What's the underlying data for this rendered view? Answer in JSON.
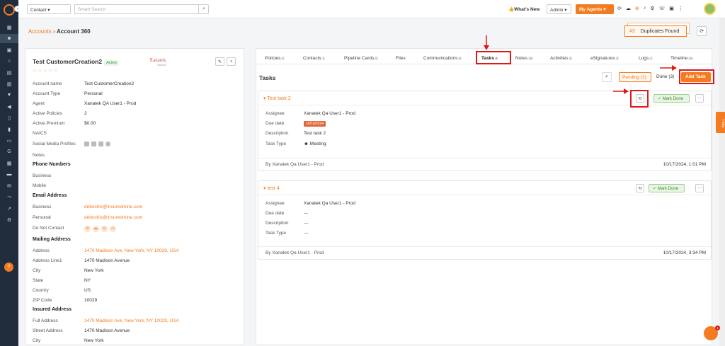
{
  "topbar": {
    "contact_select": "Contact",
    "search_placeholder": "Smart Search",
    "whats_new": "What's New",
    "admin_select": "Admin",
    "my_agents": "My Agents"
  },
  "breadcrumb": {
    "parent": "Accounts",
    "current": "Account 360"
  },
  "duplicates": {
    "count": "#3",
    "label": "Duplicates Found"
  },
  "account": {
    "name": "Test CustomerCreation2",
    "status": "Active",
    "logo_text": "Xanatek",
    "logo_sub": "Insured",
    "stars": "☆☆☆☆☆",
    "fields": [
      {
        "label": "Account name",
        "value": "Test CustomerCreation2"
      },
      {
        "label": "Account Type",
        "value": "Personal"
      },
      {
        "label": "Agent",
        "value": "Xanatek QA User1 - Prod"
      },
      {
        "label": "Active Policies",
        "value": "2"
      },
      {
        "label": "Active Premium",
        "value": "$0.00"
      },
      {
        "label": "NAICS",
        "value": ""
      },
      {
        "label": "Social Media Profiles",
        "value": ""
      },
      {
        "label": "Notes",
        "value": ""
      }
    ],
    "phone_header": "Phone Numbers",
    "phone": [
      {
        "label": "Business",
        "value": ""
      },
      {
        "label": "Mobile",
        "value": ""
      }
    ],
    "email_header": "Email Address",
    "email": [
      {
        "label": "Business",
        "value": "deboshis@insuredmine.com"
      },
      {
        "label": "Personal",
        "value": "deboshis@insuredmine.com"
      },
      {
        "label": "Do Not Contact",
        "value": ""
      }
    ],
    "mailing_header": "Mailing Address",
    "mailing": [
      {
        "label": "Address",
        "value": "1470 Madison Ave, New York, NY 10029, USA"
      },
      {
        "label": "Address Line1",
        "value": "1470 Madison Avenue"
      },
      {
        "label": "City",
        "value": "New York"
      },
      {
        "label": "State",
        "value": "NY"
      },
      {
        "label": "Country",
        "value": "US"
      },
      {
        "label": "ZIP Code",
        "value": "10029"
      }
    ],
    "insured_header": "Insured Address",
    "insured": [
      {
        "label": "Full Address",
        "value": "1470 Madison Ave, New York, NY 10029, USA"
      },
      {
        "label": "Street Address",
        "value": "1470 Madison Avenue"
      },
      {
        "label": "City",
        "value": "New York"
      }
    ]
  },
  "tabs": [
    {
      "label": "Policies",
      "count": "2"
    },
    {
      "label": "Contacts",
      "count": "1"
    },
    {
      "label": "Pipeline Cards",
      "count": "0"
    },
    {
      "label": "Files",
      "count": ""
    },
    {
      "label": "Communications",
      "count": "0"
    },
    {
      "label": "Tasks",
      "count": "0"
    },
    {
      "label": "Notes",
      "count": "10"
    },
    {
      "label": "Activities",
      "count": "0"
    },
    {
      "label": "eSignatures",
      "count": "0"
    },
    {
      "label": "Logs",
      "count": "1"
    },
    {
      "label": "Timeline",
      "count": "41"
    }
  ],
  "tasks": {
    "header": "Tasks",
    "pending": "Pending (2)",
    "done": "Done (3)",
    "add": "Add Task",
    "mark_done": "Mark Done",
    "items": [
      {
        "title": "Test task 2",
        "assignee_label": "Assignee",
        "assignee": "Xanatek Qa User1 - Prod",
        "due_label": "Due date",
        "due": "10/16/2024",
        "desc_label": "Description",
        "desc": "Test task 2",
        "type_label": "Task Type",
        "type": "Meeting",
        "by": "By Xanatek Qa User1 - Prod",
        "timestamp": "10/17/2024, 1:01 PM"
      },
      {
        "title": "test 4",
        "assignee_label": "Assignee",
        "assignee": "Xanatek Qa User1 - Prod",
        "due_label": "Due date",
        "due": "---",
        "desc_label": "Description",
        "desc": "---",
        "type_label": "Task Type",
        "type": "---",
        "by": "By Xanatek Qa User1 - Prod",
        "timestamp": "10/17/2024, 3:34 PM"
      }
    ]
  },
  "help_tab": "Help",
  "chat_badge": "1",
  "colors": {
    "accent": "#f47b20",
    "sidebar": "#1f2d3d",
    "highlight": "#e01818"
  }
}
